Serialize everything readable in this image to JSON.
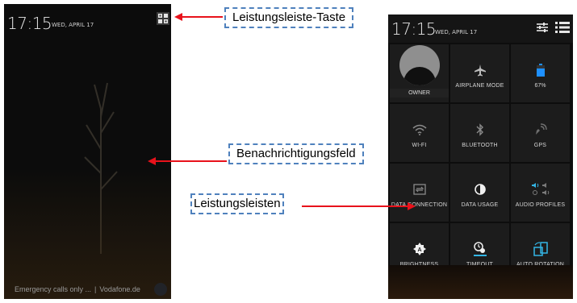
{
  "notification_panel": {
    "time": "17:15",
    "date": "WED, APRIL 17",
    "carrier_status": "Emergency calls only ...",
    "separator": "|",
    "carrier_name": "Vodafone.de"
  },
  "quick_settings": {
    "time": "17:15",
    "date": "WED, APRIL 17",
    "tiles": [
      {
        "label": "OWNER",
        "icon": "owner-avatar-icon"
      },
      {
        "label": "AIRPLANE MODE",
        "icon": "airplane-icon"
      },
      {
        "label": "67%",
        "icon": "battery-icon"
      },
      {
        "label": "WI-FI",
        "icon": "wifi-icon"
      },
      {
        "label": "BLUETOOTH",
        "icon": "bluetooth-icon"
      },
      {
        "label": "GPS",
        "icon": "gps-icon"
      },
      {
        "label": "DATA CONNECTION",
        "icon": "data-connection-icon"
      },
      {
        "label": "DATA USAGE",
        "icon": "data-usage-icon"
      },
      {
        "label": "AUDIO PROFILES",
        "icon": "audio-profiles-icon"
      },
      {
        "label": "BRIGHTNESS",
        "icon": "brightness-icon"
      },
      {
        "label": "TIMEOUT",
        "icon": "timeout-icon"
      },
      {
        "label": "AUTO ROTATION",
        "icon": "auto-rotation-icon"
      }
    ]
  },
  "callouts": {
    "toggle_button": "Leistungsleiste-Taste",
    "notification_field": "Benachrichtigungsfeld",
    "power_bars": "Leistungsleisten"
  },
  "colors": {
    "arrow": "#e8121b",
    "callout_border": "#4f81bd",
    "battery": "#1e90ff",
    "accent_blue": "#33b5e5"
  }
}
